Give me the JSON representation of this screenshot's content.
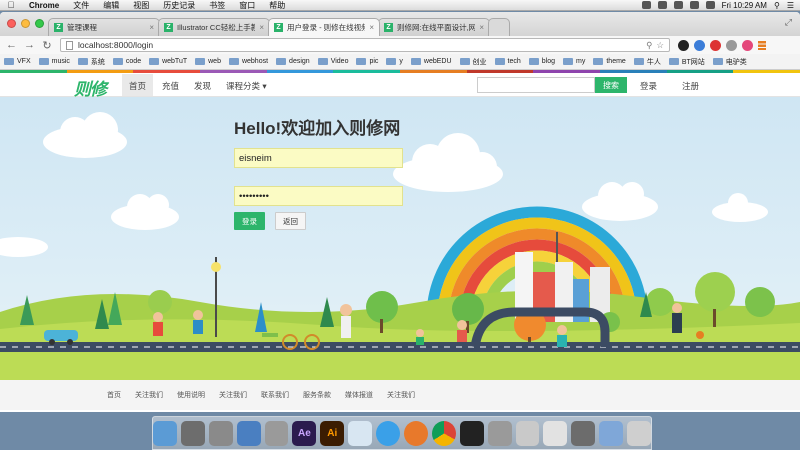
{
  "menubar": {
    "app": "Chrome",
    "items": [
      "文件",
      "编辑",
      "视图",
      "历史记录",
      "书签",
      "窗口",
      "帮助"
    ],
    "clock": "Fri 10:29 AM"
  },
  "tabs": [
    {
      "title": "管理课程",
      "active": false
    },
    {
      "title": "Illustrator CC轻松上手教程",
      "active": false
    },
    {
      "title": "用户登录 - 则修在线视频培训",
      "active": true
    },
    {
      "title": "则修网:在线平面设计,网站开发",
      "active": false
    }
  ],
  "address": {
    "url": "localhost:8000/login"
  },
  "bookmarks": [
    "VFX",
    "music",
    "系统",
    "code",
    "webTuT",
    "web",
    "webhost",
    "design",
    "Video",
    "pic",
    "y",
    "webEDU",
    "创业",
    "tech",
    "blog",
    "my",
    "theme",
    "牛人",
    "BT网站",
    "电驴类"
  ],
  "site": {
    "logo": "则修",
    "nav": [
      "首页",
      "充值",
      "发现",
      "课程分类 ▾"
    ],
    "search_button": "搜索",
    "login_link": "登录",
    "register_link": "注册"
  },
  "login": {
    "heading": "Hello!欢迎加入则修网",
    "username": "eisneim",
    "password": "•••••••••",
    "submit": "登录",
    "back": "返回"
  },
  "footer": [
    "首页",
    "关注我们",
    "使用说明",
    "关注我们",
    "联系我们",
    "服务条款",
    "媒体报道",
    "关注我们"
  ],
  "colors": {
    "brand": "#2db56b",
    "input_bg": "#fbfbc4"
  }
}
